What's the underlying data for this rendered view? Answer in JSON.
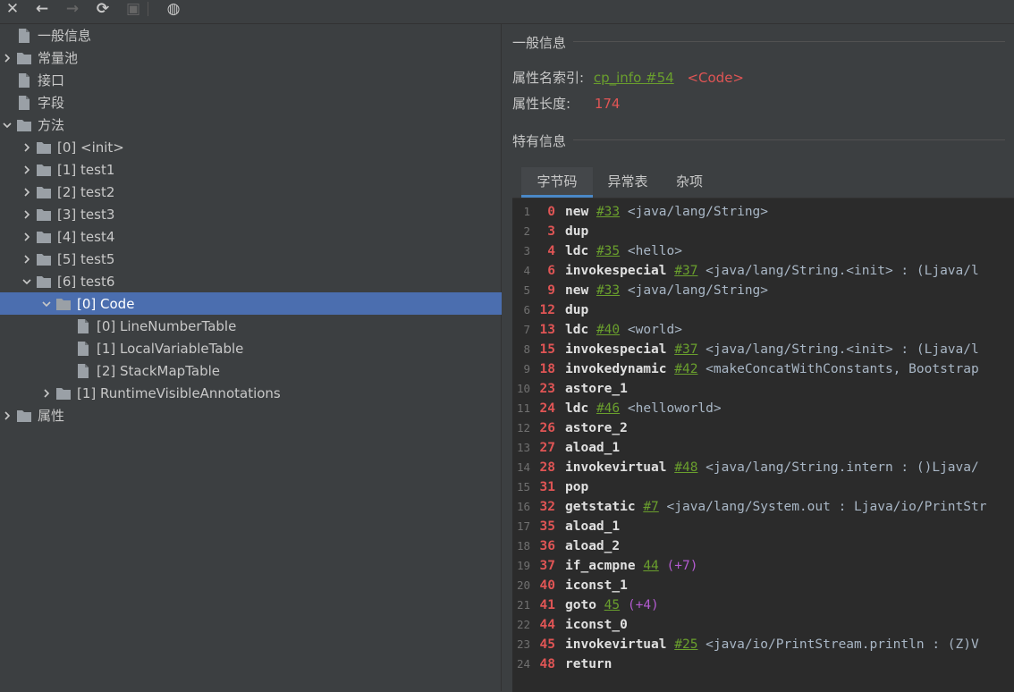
{
  "toolbar": {
    "buttons": [
      {
        "name": "close-icon",
        "glyph": "✕",
        "enabled": true
      },
      {
        "name": "back-icon",
        "glyph": "←",
        "enabled": true
      },
      {
        "name": "forward-icon",
        "glyph": "→",
        "enabled": false
      },
      {
        "name": "refresh-icon",
        "glyph": "⟳",
        "enabled": true
      },
      {
        "name": "save-icon",
        "glyph": "▣",
        "enabled": false
      },
      {
        "name": "globe-icon",
        "glyph": "◍",
        "enabled": true
      }
    ]
  },
  "tree": [
    {
      "label": "一般信息",
      "depth": 0,
      "type": "file",
      "expand": "none"
    },
    {
      "label": "常量池",
      "depth": 0,
      "type": "folder",
      "expand": "collapsed"
    },
    {
      "label": "接口",
      "depth": 0,
      "type": "file",
      "expand": "none"
    },
    {
      "label": "字段",
      "depth": 0,
      "type": "file",
      "expand": "none"
    },
    {
      "label": "方法",
      "depth": 0,
      "type": "folder",
      "expand": "expanded"
    },
    {
      "label": "[0] <init>",
      "depth": 1,
      "type": "folder",
      "expand": "collapsed"
    },
    {
      "label": "[1] test1",
      "depth": 1,
      "type": "folder",
      "expand": "collapsed"
    },
    {
      "label": "[2] test2",
      "depth": 1,
      "type": "folder",
      "expand": "collapsed"
    },
    {
      "label": "[3] test3",
      "depth": 1,
      "type": "folder",
      "expand": "collapsed"
    },
    {
      "label": "[4] test4",
      "depth": 1,
      "type": "folder",
      "expand": "collapsed"
    },
    {
      "label": "[5] test5",
      "depth": 1,
      "type": "folder",
      "expand": "collapsed"
    },
    {
      "label": "[6] test6",
      "depth": 1,
      "type": "folder",
      "expand": "expanded"
    },
    {
      "label": "[0] Code",
      "depth": 2,
      "type": "folder",
      "expand": "expanded",
      "selected": true
    },
    {
      "label": "[0] LineNumberTable",
      "depth": 3,
      "type": "file",
      "expand": "none"
    },
    {
      "label": "[1] LocalVariableTable",
      "depth": 3,
      "type": "file",
      "expand": "none"
    },
    {
      "label": "[2] StackMapTable",
      "depth": 3,
      "type": "file",
      "expand": "none"
    },
    {
      "label": "[1] RuntimeVisibleAnnotations",
      "depth": 2,
      "type": "folder",
      "expand": "collapsed"
    },
    {
      "label": "属性",
      "depth": 0,
      "type": "folder",
      "expand": "collapsed"
    }
  ],
  "general": {
    "title": "一般信息",
    "name_index_label": "属性名索引:",
    "name_index_link": "cp_info #54",
    "name_index_value": "<Code>",
    "length_label": "属性长度:",
    "length_value": "174"
  },
  "specific": {
    "title": "特有信息",
    "tabs": [
      {
        "label": "字节码",
        "active": true
      },
      {
        "label": "异常表",
        "active": false
      },
      {
        "label": "杂项",
        "active": false
      }
    ]
  },
  "bytecode": [
    {
      "line": "1",
      "offset": "0",
      "op": "new",
      "ref": "#33",
      "arg": "<java/lang/String>"
    },
    {
      "line": "2",
      "offset": "3",
      "op": "dup"
    },
    {
      "line": "3",
      "offset": "4",
      "op": "ldc",
      "ref": "#35",
      "arg": "<hello>"
    },
    {
      "line": "4",
      "offset": "6",
      "op": "invokespecial",
      "ref": "#37",
      "arg": "<java/lang/String.<init> : (Ljava/l"
    },
    {
      "line": "5",
      "offset": "9",
      "op": "new",
      "ref": "#33",
      "arg": "<java/lang/String>"
    },
    {
      "line": "6",
      "offset": "12",
      "op": "dup"
    },
    {
      "line": "7",
      "offset": "13",
      "op": "ldc",
      "ref": "#40",
      "arg": "<world>"
    },
    {
      "line": "8",
      "offset": "15",
      "op": "invokespecial",
      "ref": "#37",
      "arg": "<java/lang/String.<init> : (Ljava/l"
    },
    {
      "line": "9",
      "offset": "18",
      "op": "invokedynamic",
      "ref": "#42",
      "arg": "<makeConcatWithConstants, Bootstrap"
    },
    {
      "line": "10",
      "offset": "23",
      "op": "astore_1"
    },
    {
      "line": "11",
      "offset": "24",
      "op": "ldc",
      "ref": "#46",
      "arg": "<helloworld>"
    },
    {
      "line": "12",
      "offset": "26",
      "op": "astore_2"
    },
    {
      "line": "13",
      "offset": "27",
      "op": "aload_1"
    },
    {
      "line": "14",
      "offset": "28",
      "op": "invokevirtual",
      "ref": "#48",
      "arg": "<java/lang/String.intern : ()Ljava/"
    },
    {
      "line": "15",
      "offset": "31",
      "op": "pop"
    },
    {
      "line": "16",
      "offset": "32",
      "op": "getstatic",
      "ref": "#7",
      "arg": "<java/lang/System.out : Ljava/io/PrintStr"
    },
    {
      "line": "17",
      "offset": "35",
      "op": "aload_1"
    },
    {
      "line": "18",
      "offset": "36",
      "op": "aload_2"
    },
    {
      "line": "19",
      "offset": "37",
      "op": "if_acmpne",
      "ref": "44",
      "jump": "(+7)"
    },
    {
      "line": "20",
      "offset": "40",
      "op": "iconst_1"
    },
    {
      "line": "21",
      "offset": "41",
      "op": "goto",
      "ref": "45",
      "jump": "(+4)"
    },
    {
      "line": "22",
      "offset": "44",
      "op": "iconst_0"
    },
    {
      "line": "23",
      "offset": "45",
      "op": "invokevirtual",
      "ref": "#25",
      "arg": "<java/io/PrintStream.println : (Z)V"
    },
    {
      "line": "24",
      "offset": "48",
      "op": "return"
    }
  ],
  "colors": {
    "background": "#3c3f41",
    "editor": "#2b2b2b",
    "selection": "#4b6eaf",
    "link": "#6a9f2d",
    "offset": "#e05555",
    "jump": "#b35bd0"
  }
}
